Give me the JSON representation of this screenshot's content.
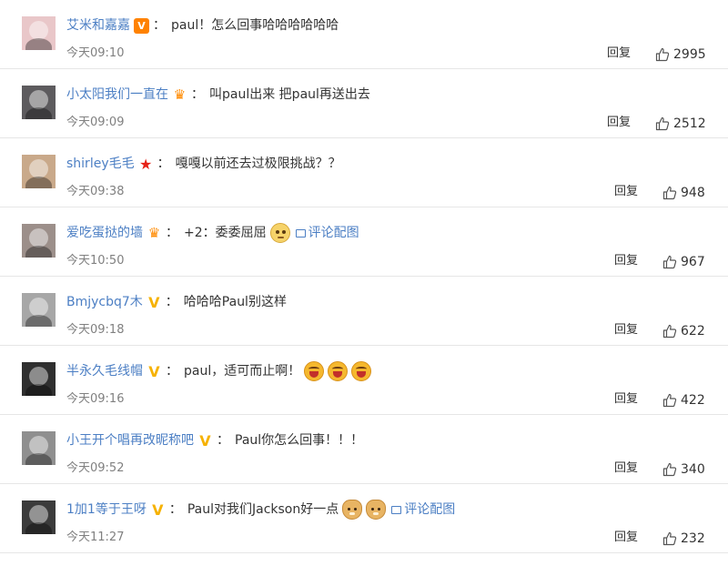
{
  "comments": [
    {
      "username": "艾米和嘉嘉",
      "badge": "v-box",
      "badge_glyph": "V",
      "text": "paul！怎么回事哈哈哈哈哈哈",
      "emojis": [],
      "pic_link": "",
      "time": "今天09:10",
      "reply": "回复",
      "likes": "2995"
    },
    {
      "username": "小太阳我们一直在",
      "badge": "crown",
      "badge_glyph": "♛",
      "text": "叫paul出来 把paul再送出去",
      "emojis": [],
      "pic_link": "",
      "time": "今天09:09",
      "reply": "回复",
      "likes": "2512"
    },
    {
      "username": "shirley毛毛",
      "badge": "star",
      "badge_glyph": "★",
      "text": "嘎嘎以前还去过极限挑战？？",
      "emojis": [],
      "pic_link": "",
      "time": "今天09:38",
      "reply": "回复",
      "likes": "948"
    },
    {
      "username": "爱吃蛋挞的墙",
      "badge": "crown",
      "badge_glyph": "♛",
      "text": "+2：委委屈屈",
      "emojis": [
        "grievance"
      ],
      "pic_link": "评论配图",
      "time": "今天10:50",
      "reply": "回复",
      "likes": "967"
    },
    {
      "username": "Bmjycbq7木",
      "badge": "v-gold",
      "badge_glyph": "V",
      "text": "哈哈哈Paul别这样",
      "emojis": [],
      "pic_link": "",
      "time": "今天09:18",
      "reply": "回复",
      "likes": "622"
    },
    {
      "username": "半永久毛线帽",
      "badge": "v-gold",
      "badge_glyph": "V",
      "text": "paul，适可而止啊！",
      "emojis": [
        "laugh",
        "laugh",
        "laugh"
      ],
      "pic_link": "",
      "time": "今天09:16",
      "reply": "回复",
      "likes": "422"
    },
    {
      "username": "小王开个唱再改昵称吧",
      "badge": "v-gold",
      "badge_glyph": "V",
      "text": "Paul你怎么回事！！！",
      "emojis": [],
      "pic_link": "",
      "time": "今天09:52",
      "reply": "回复",
      "likes": "340"
    },
    {
      "username": "1加1等于王呀",
      "badge": "v-gold",
      "badge_glyph": "V",
      "text": "Paul对我们Jackson好一点",
      "emojis": [
        "doge",
        "doge"
      ],
      "pic_link": "评论配图",
      "time": "今天11:27",
      "reply": "回复",
      "likes": "232"
    }
  ],
  "colors": {
    "username": "#4c7fc4",
    "timestamp": "#808080",
    "divider": "#e6e6e6",
    "vip_orange": "#ff8200",
    "verified_gold": "#f6b200"
  },
  "icons": {
    "like": "thumbs-up-icon",
    "picture": "picture-icon"
  }
}
